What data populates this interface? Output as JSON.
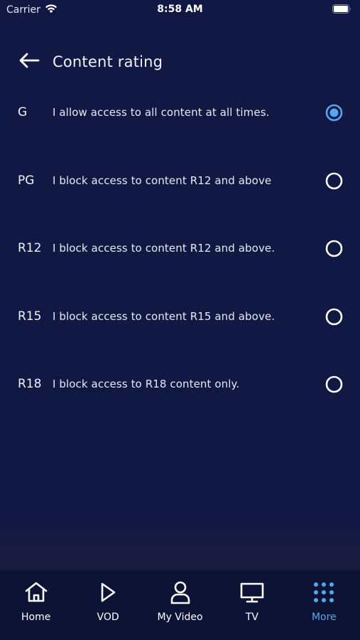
{
  "status_bar": {
    "carrier": "Carrier",
    "time": "8:58 AM"
  },
  "header": {
    "title": "Content rating"
  },
  "ratings": [
    {
      "code": "G",
      "description": "I allow access to all content at all times.",
      "selected": true
    },
    {
      "code": "PG",
      "description": "I block access to content R12 and above",
      "selected": false
    },
    {
      "code": "R12",
      "description": "I block access to content R12 and above.",
      "selected": false
    },
    {
      "code": "R15",
      "description": "I block access to content R15 and above.",
      "selected": false
    },
    {
      "code": "R18",
      "description": "I block access to R18 content only.",
      "selected": false
    }
  ],
  "tab_bar": {
    "tabs": [
      {
        "label": "Home",
        "icon": "home-icon",
        "active": false
      },
      {
        "label": "VOD",
        "icon": "play-icon",
        "active": false
      },
      {
        "label": "My Video",
        "icon": "user-icon",
        "active": false
      },
      {
        "label": "TV",
        "icon": "tv-icon",
        "active": false
      },
      {
        "label": "More",
        "icon": "grid-icon",
        "active": true
      }
    ]
  },
  "colors": {
    "background": "#101843",
    "accent": "#55a8ef",
    "tab_bar": "#0c1335",
    "text": "#ffffff"
  }
}
